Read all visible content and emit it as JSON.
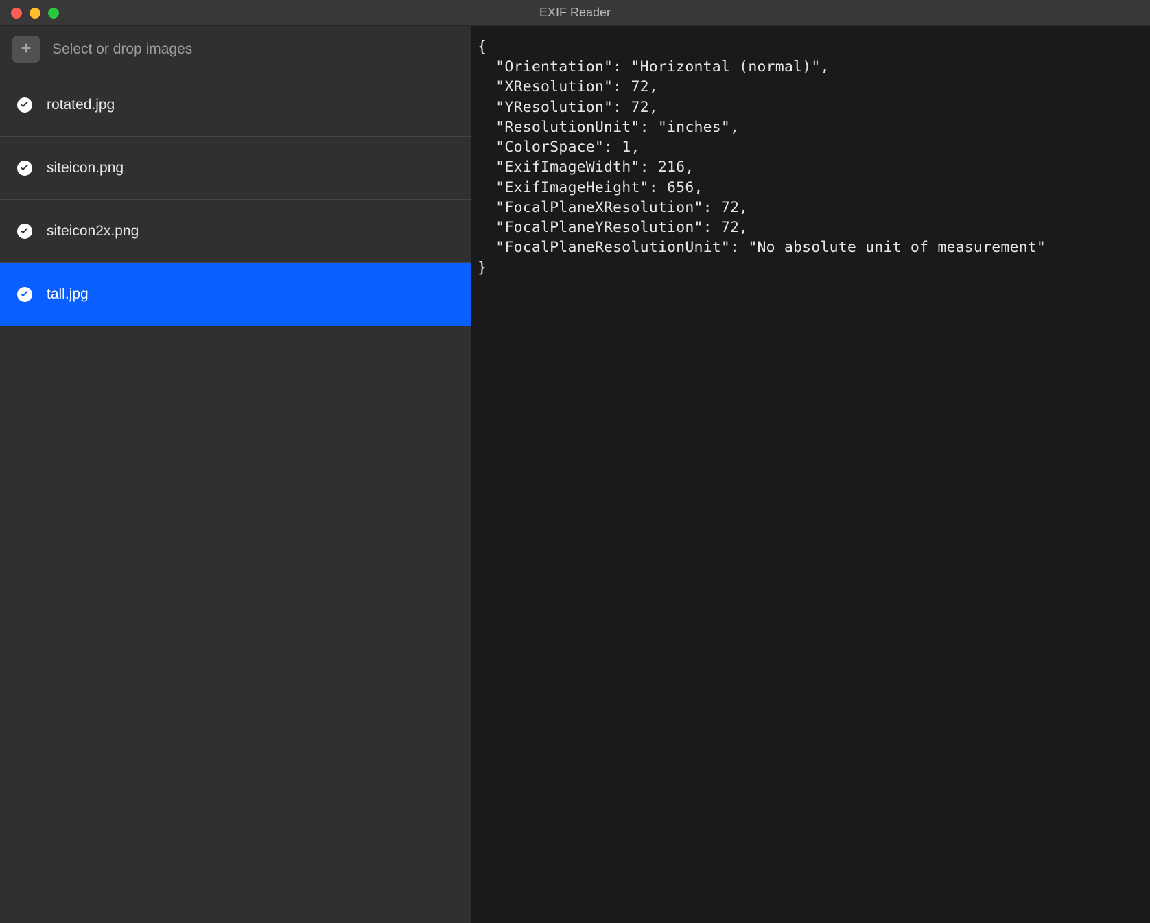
{
  "window": {
    "title": "EXIF Reader"
  },
  "sidebar": {
    "dropzone_label": "Select or drop images",
    "files": [
      {
        "name": "rotated.jpg",
        "selected": false
      },
      {
        "name": "siteicon.png",
        "selected": false
      },
      {
        "name": "siteicon2x.png",
        "selected": false
      },
      {
        "name": "tall.jpg",
        "selected": true
      }
    ]
  },
  "exif": {
    "Orientation": "Horizontal (normal)",
    "XResolution": 72,
    "YResolution": 72,
    "ResolutionUnit": "inches",
    "ColorSpace": 1,
    "ExifImageWidth": 216,
    "ExifImageHeight": 656,
    "FocalPlaneXResolution": 72,
    "FocalPlaneYResolution": 72,
    "FocalPlaneResolutionUnit": "No absolute unit of measurement"
  }
}
